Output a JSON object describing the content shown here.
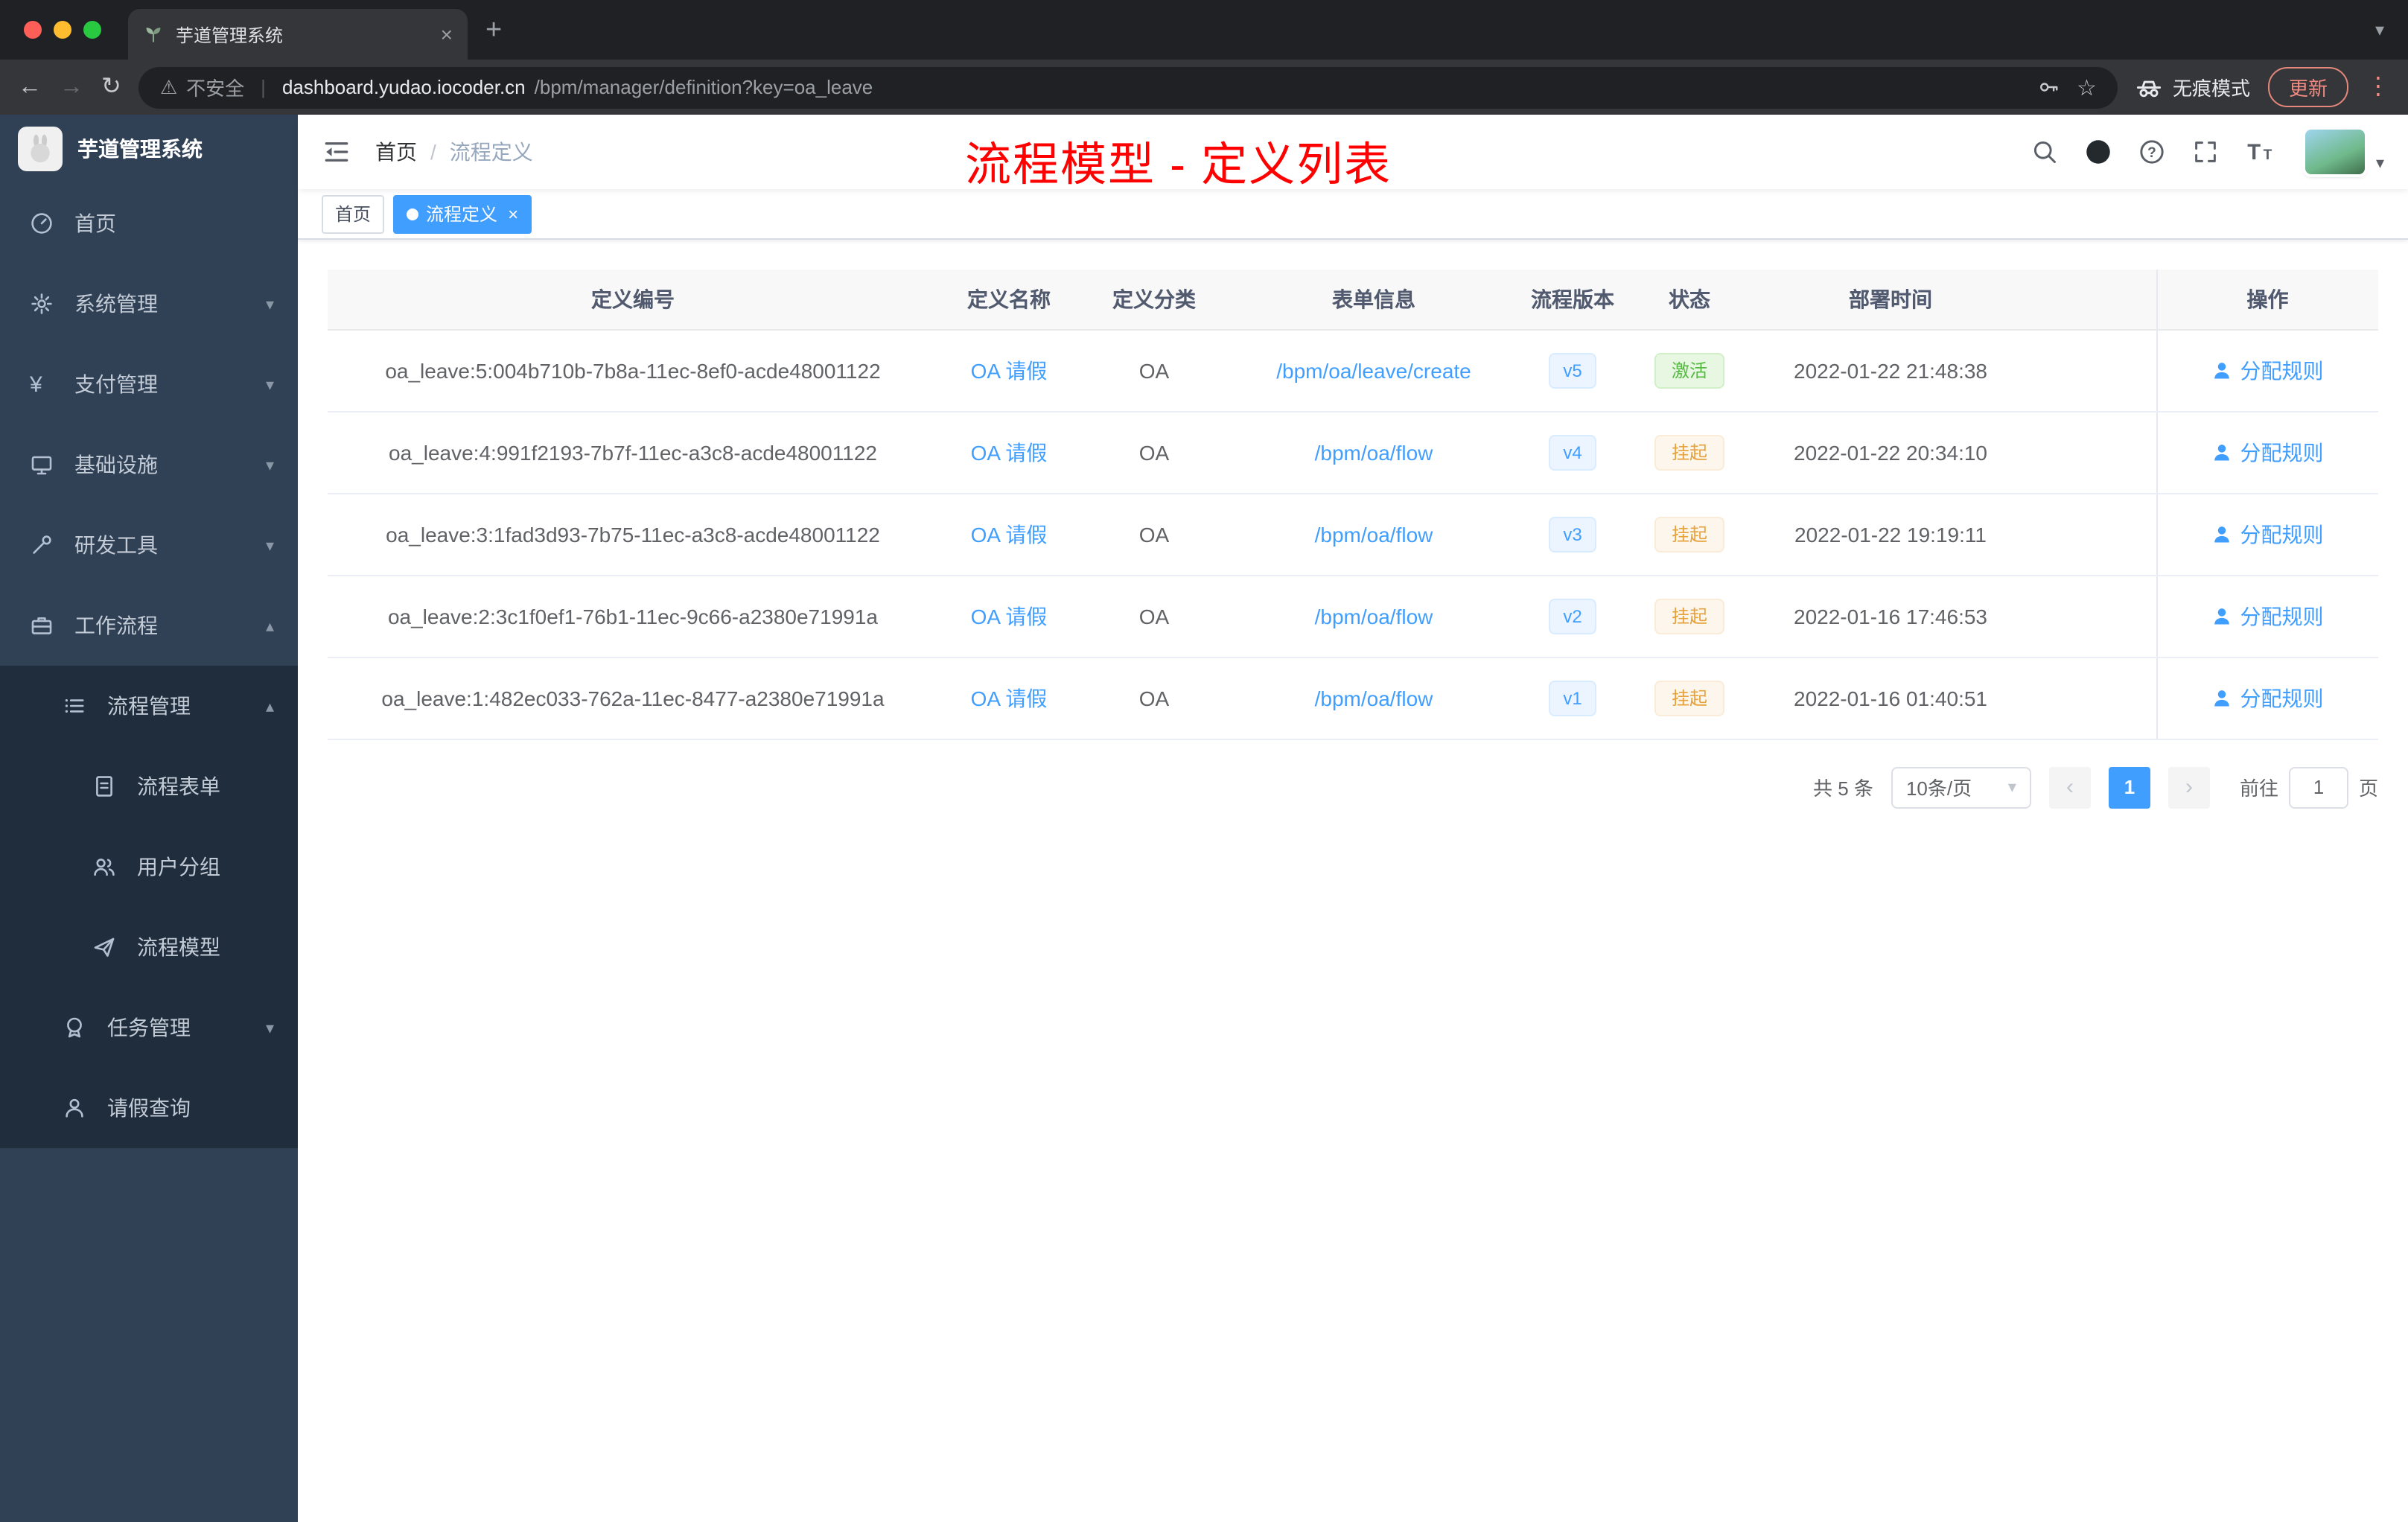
{
  "browser": {
    "tab_title": "芋道管理系统",
    "security_label": "不安全",
    "url_host": "dashboard.yudao.iocoder.cn",
    "url_path": "/bpm/manager/definition?key=oa_leave",
    "incognito_label": "无痕模式",
    "update_label": "更新"
  },
  "icons": {
    "back": "←",
    "forward": "→",
    "reload": "↻",
    "warning": "⚠",
    "pipe": "|",
    "star": "☆",
    "dots": "⋮",
    "close": "×",
    "plus": "+",
    "caret_down": "▾",
    "caret_up": "▴",
    "prev": "‹",
    "next": "›"
  },
  "sidebar": {
    "app_title": "芋道管理系统",
    "items": [
      {
        "label": "首页"
      },
      {
        "label": "系统管理"
      },
      {
        "label": "支付管理"
      },
      {
        "label": "基础设施"
      },
      {
        "label": "研发工具"
      },
      {
        "label": "工作流程"
      },
      {
        "label": "流程管理"
      },
      {
        "label": "流程表单"
      },
      {
        "label": "用户分组"
      },
      {
        "label": "流程模型"
      },
      {
        "label": "任务管理"
      },
      {
        "label": "请假查询"
      }
    ]
  },
  "navbar": {
    "breadcrumb": [
      "首页",
      "流程定义"
    ],
    "separator": "/",
    "annotation": "流程模型 - 定义列表"
  },
  "tags": {
    "home": "首页",
    "current": "流程定义"
  },
  "table": {
    "columns": [
      "定义编号",
      "定义名称",
      "定义分类",
      "表单信息",
      "流程版本",
      "状态",
      "部署时间",
      "操作"
    ],
    "rows": [
      {
        "id": "oa_leave:5:004b710b-7b8a-11ec-8ef0-acde48001122",
        "name": "OA 请假",
        "category": "OA",
        "form": "/bpm/oa/leave/create",
        "version": "v5",
        "status": "激活",
        "status_type": "success",
        "time": "2022-01-22 21:48:38",
        "action": "分配规则"
      },
      {
        "id": "oa_leave:4:991f2193-7b7f-11ec-a3c8-acde48001122",
        "name": "OA 请假",
        "category": "OA",
        "form": "/bpm/oa/flow",
        "version": "v4",
        "status": "挂起",
        "status_type": "warning",
        "time": "2022-01-22 20:34:10",
        "action": "分配规则"
      },
      {
        "id": "oa_leave:3:1fad3d93-7b75-11ec-a3c8-acde48001122",
        "name": "OA 请假",
        "category": "OA",
        "form": "/bpm/oa/flow",
        "version": "v3",
        "status": "挂起",
        "status_type": "warning",
        "time": "2022-01-22 19:19:11",
        "action": "分配规则"
      },
      {
        "id": "oa_leave:2:3c1f0ef1-76b1-11ec-9c66-a2380e71991a",
        "name": "OA 请假",
        "category": "OA",
        "form": "/bpm/oa/flow",
        "version": "v2",
        "status": "挂起",
        "status_type": "warning",
        "time": "2022-01-16 17:46:53",
        "action": "分配规则"
      },
      {
        "id": "oa_leave:1:482ec033-762a-11ec-8477-a2380e71991a",
        "name": "OA 请假",
        "category": "OA",
        "form": "/bpm/oa/flow",
        "version": "v1",
        "status": "挂起",
        "status_type": "warning",
        "time": "2022-01-16 01:40:51",
        "action": "分配规则"
      }
    ]
  },
  "pagination": {
    "total": "共 5 条",
    "page_size": "10条/页",
    "current_page": "1",
    "goto_label": "前往",
    "goto_page": "1",
    "goto_unit": "页"
  },
  "colors": {
    "accent": "#409EFF",
    "success_text": "#53B93F",
    "warning_text": "#E6A23C",
    "annotation_red": "#FF0000",
    "sidebar_bg": "#304156",
    "submenu_bg": "#1F2D3D"
  }
}
